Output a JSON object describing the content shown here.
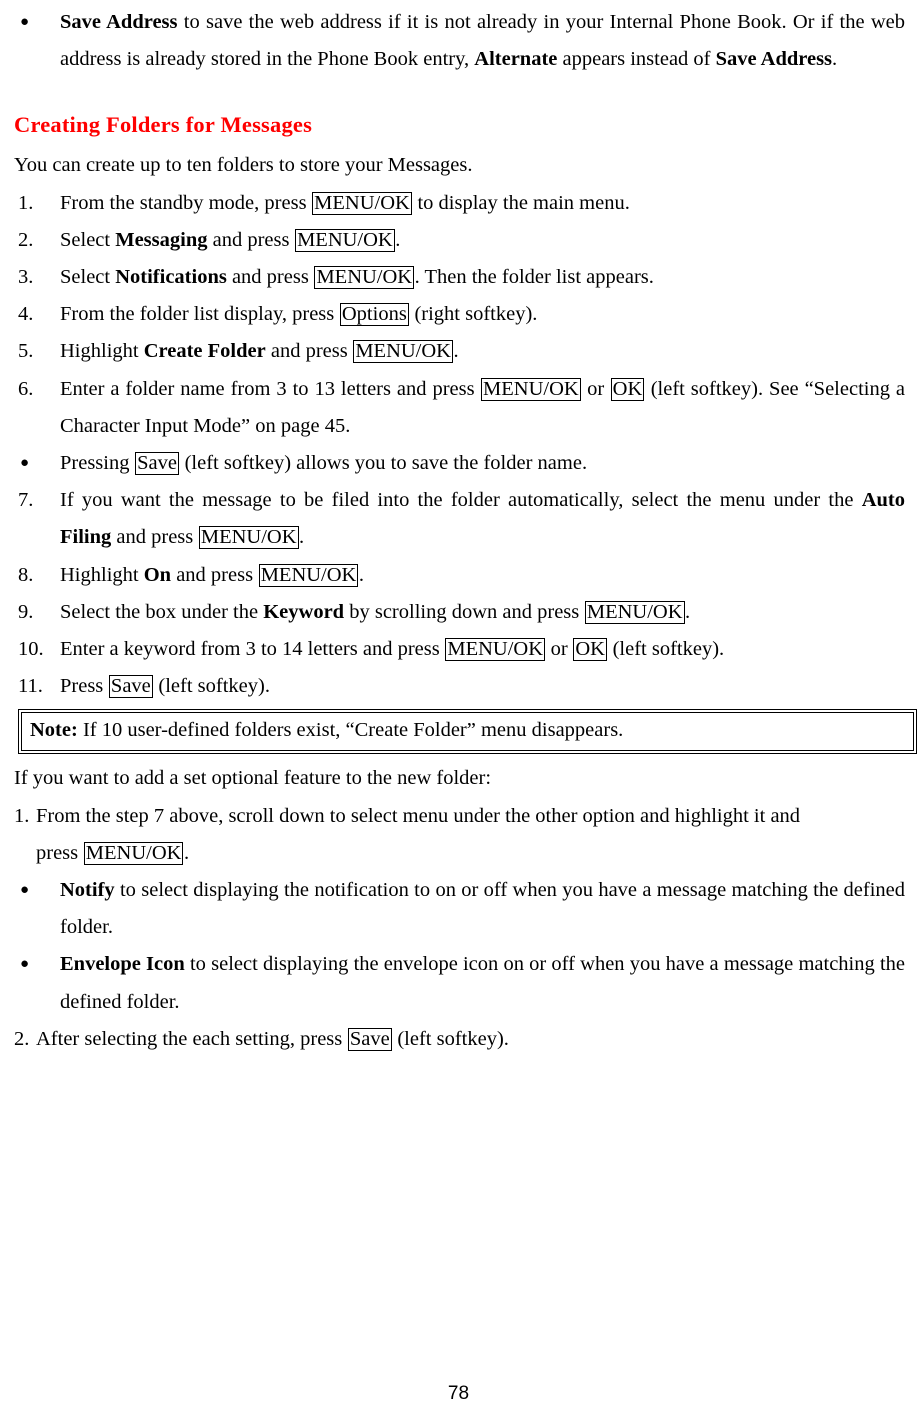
{
  "document": {
    "page_number": "78",
    "heading": "Creating Folders for Messages",
    "heading_color": "#FF0000"
  },
  "intro_bullet": {
    "marker": "●",
    "term": "Save Address",
    "text_1": " to save the web address if it is not already in your Internal Phone Book. Or if the web address is already stored in the Phone Book entry, ",
    "term_2": "Alternate",
    "text_2": " appears instead of ",
    "term_3": "Save Address",
    "text_3": "."
  },
  "lead_in": "You can create up to ten folders to store your Messages.",
  "steps": [
    {
      "marker": "1.",
      "parts": [
        {
          "type": "text",
          "value": "From the standby mode, press "
        },
        {
          "type": "key",
          "value": "MENU/OK"
        },
        {
          "type": "text",
          "value": " to display the main menu."
        }
      ]
    },
    {
      "marker": "2.",
      "parts": [
        {
          "type": "text",
          "value": "Select "
        },
        {
          "type": "bold",
          "value": "Messaging"
        },
        {
          "type": "text",
          "value": " and press "
        },
        {
          "type": "key",
          "value": "MENU/OK"
        },
        {
          "type": "text",
          "value": "."
        }
      ]
    },
    {
      "marker": "3.",
      "parts": [
        {
          "type": "text",
          "value": "Select "
        },
        {
          "type": "bold",
          "value": "Notifications"
        },
        {
          "type": "text",
          "value": " and press "
        },
        {
          "type": "key",
          "value": "MENU/OK"
        },
        {
          "type": "text",
          "value": ". Then the folder list appears."
        }
      ]
    },
    {
      "marker": "4.",
      "parts": [
        {
          "type": "text",
          "value": "From the folder list display, press "
        },
        {
          "type": "key",
          "value": "Options"
        },
        {
          "type": "text",
          "value": " (right softkey)."
        }
      ]
    },
    {
      "marker": "5.",
      "parts": [
        {
          "type": "text",
          "value": "Highlight "
        },
        {
          "type": "bold",
          "value": "Create Folder"
        },
        {
          "type": "text",
          "value": " and press "
        },
        {
          "type": "key",
          "value": "MENU/OK"
        },
        {
          "type": "text",
          "value": "."
        }
      ]
    },
    {
      "marker": "6.",
      "justify": true,
      "parts": [
        {
          "type": "text",
          "value": "Enter a folder name from 3 to 13 letters and press "
        },
        {
          "type": "key",
          "value": "MENU/OK"
        },
        {
          "type": "text",
          "value": " or "
        },
        {
          "type": "key",
          "value": "OK"
        },
        {
          "type": "text",
          "value": " (left softkey). See “Selecting a Character Input Mode” on page 45."
        }
      ]
    },
    {
      "marker": "●",
      "bullet": true,
      "parts": [
        {
          "type": "text",
          "value": "Pressing "
        },
        {
          "type": "key",
          "value": "Save"
        },
        {
          "type": "text",
          "value": " (left softkey) allows you to save the folder name."
        }
      ]
    },
    {
      "marker": "7.",
      "justify": true,
      "parts": [
        {
          "type": "text",
          "value": "If you want the message to be filed into the folder automatically, select the menu under the "
        },
        {
          "type": "bold",
          "value": "Auto Filing"
        },
        {
          "type": "text",
          "value": " and press "
        },
        {
          "type": "key",
          "value": "MENU/OK"
        },
        {
          "type": "text",
          "value": "."
        }
      ]
    },
    {
      "marker": "8.",
      "parts": [
        {
          "type": "text",
          "value": "Highlight "
        },
        {
          "type": "bold",
          "value": "On"
        },
        {
          "type": "text",
          "value": " and press "
        },
        {
          "type": "key",
          "value": "MENU/OK"
        },
        {
          "type": "text",
          "value": "."
        }
      ]
    },
    {
      "marker": "9.",
      "parts": [
        {
          "type": "text",
          "value": "Select the box under the "
        },
        {
          "type": "bold",
          "value": "Keyword"
        },
        {
          "type": "text",
          "value": " by scrolling down and press "
        },
        {
          "type": "key",
          "value": "MENU/OK"
        },
        {
          "type": "text",
          "value": "."
        }
      ]
    },
    {
      "marker": "10.",
      "parts": [
        {
          "type": "text",
          "value": "Enter a keyword from 3 to 14 letters and press "
        },
        {
          "type": "key",
          "value": "MENU/OK"
        },
        {
          "type": "text",
          "value": " or "
        },
        {
          "type": "key",
          "value": "OK"
        },
        {
          "type": "text",
          "value": " (left softkey)."
        }
      ]
    },
    {
      "marker": "11.",
      "parts": [
        {
          "type": "text",
          "value": "Press "
        },
        {
          "type": "key",
          "value": "Save"
        },
        {
          "type": "text",
          "value": " (left softkey)."
        }
      ]
    }
  ],
  "note": {
    "label": "Note:",
    "text": " If 10 user-defined folders exist, “Create Folder” menu disappears."
  },
  "optional_section": {
    "lead_in": "If you want to add a set optional feature to the new folder:",
    "steps": [
      {
        "marker": "1.",
        "parts": [
          {
            "type": "text",
            "value": "From the step 7 above, scroll down to select menu under the other option and highlight it and "
          },
          {
            "type": "indent",
            "value": ""
          },
          {
            "type": "text",
            "value": "press "
          },
          {
            "type": "key",
            "value": "MENU/OK"
          },
          {
            "type": "text",
            "value": "."
          }
        ]
      },
      {
        "marker": "●",
        "bullet": true,
        "justify": true,
        "parts": [
          {
            "type": "bold",
            "value": "Notify"
          },
          {
            "type": "text",
            "value": " to select displaying the notification to on or off when you have a message matching the defined folder."
          }
        ]
      },
      {
        "marker": "●",
        "bullet": true,
        "justify": true,
        "parts": [
          {
            "type": "bold",
            "value": "Envelope Icon"
          },
          {
            "type": "text",
            "value": " to select displaying the envelope icon on or off when you have a message matching the defined folder."
          }
        ]
      },
      {
        "marker": "2.",
        "parts": [
          {
            "type": "text",
            "value": "After selecting the each setting, press "
          },
          {
            "type": "key",
            "value": "Save"
          },
          {
            "type": "text",
            "value": " (left softkey)."
          }
        ]
      }
    ]
  }
}
